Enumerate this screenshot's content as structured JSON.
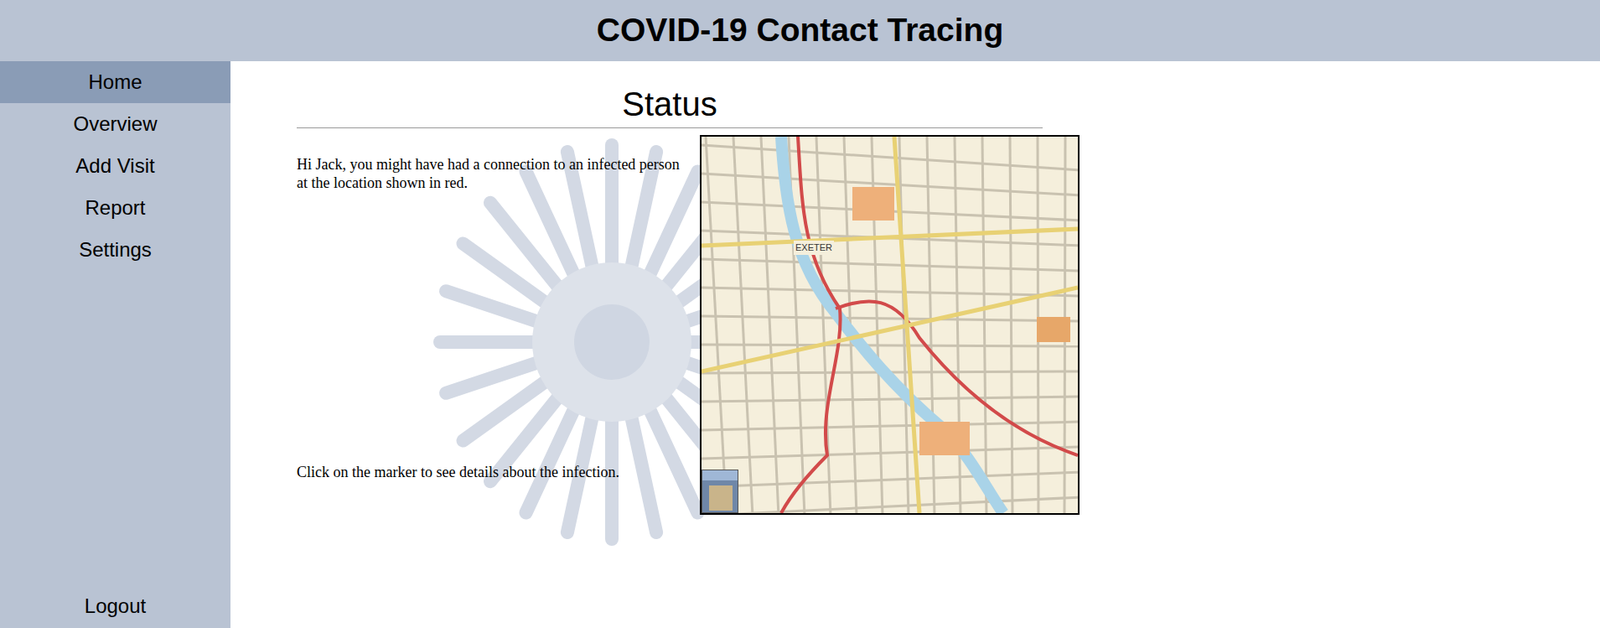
{
  "header": {
    "title": "COVID-19 Contact Tracing"
  },
  "sidebar": {
    "items": [
      {
        "label": "Home",
        "selected": true
      },
      {
        "label": "Overview",
        "selected": false
      },
      {
        "label": "Add Visit",
        "selected": false
      },
      {
        "label": "Report",
        "selected": false
      },
      {
        "label": "Settings",
        "selected": false
      }
    ],
    "logout": "Logout"
  },
  "main": {
    "heading": "Status",
    "message": "Hi Jack, you might have had a connection to an infected person at the location shown in red.",
    "instruction": "Click on the marker to see details about the infection.",
    "map": {
      "label": "EXETER"
    }
  }
}
